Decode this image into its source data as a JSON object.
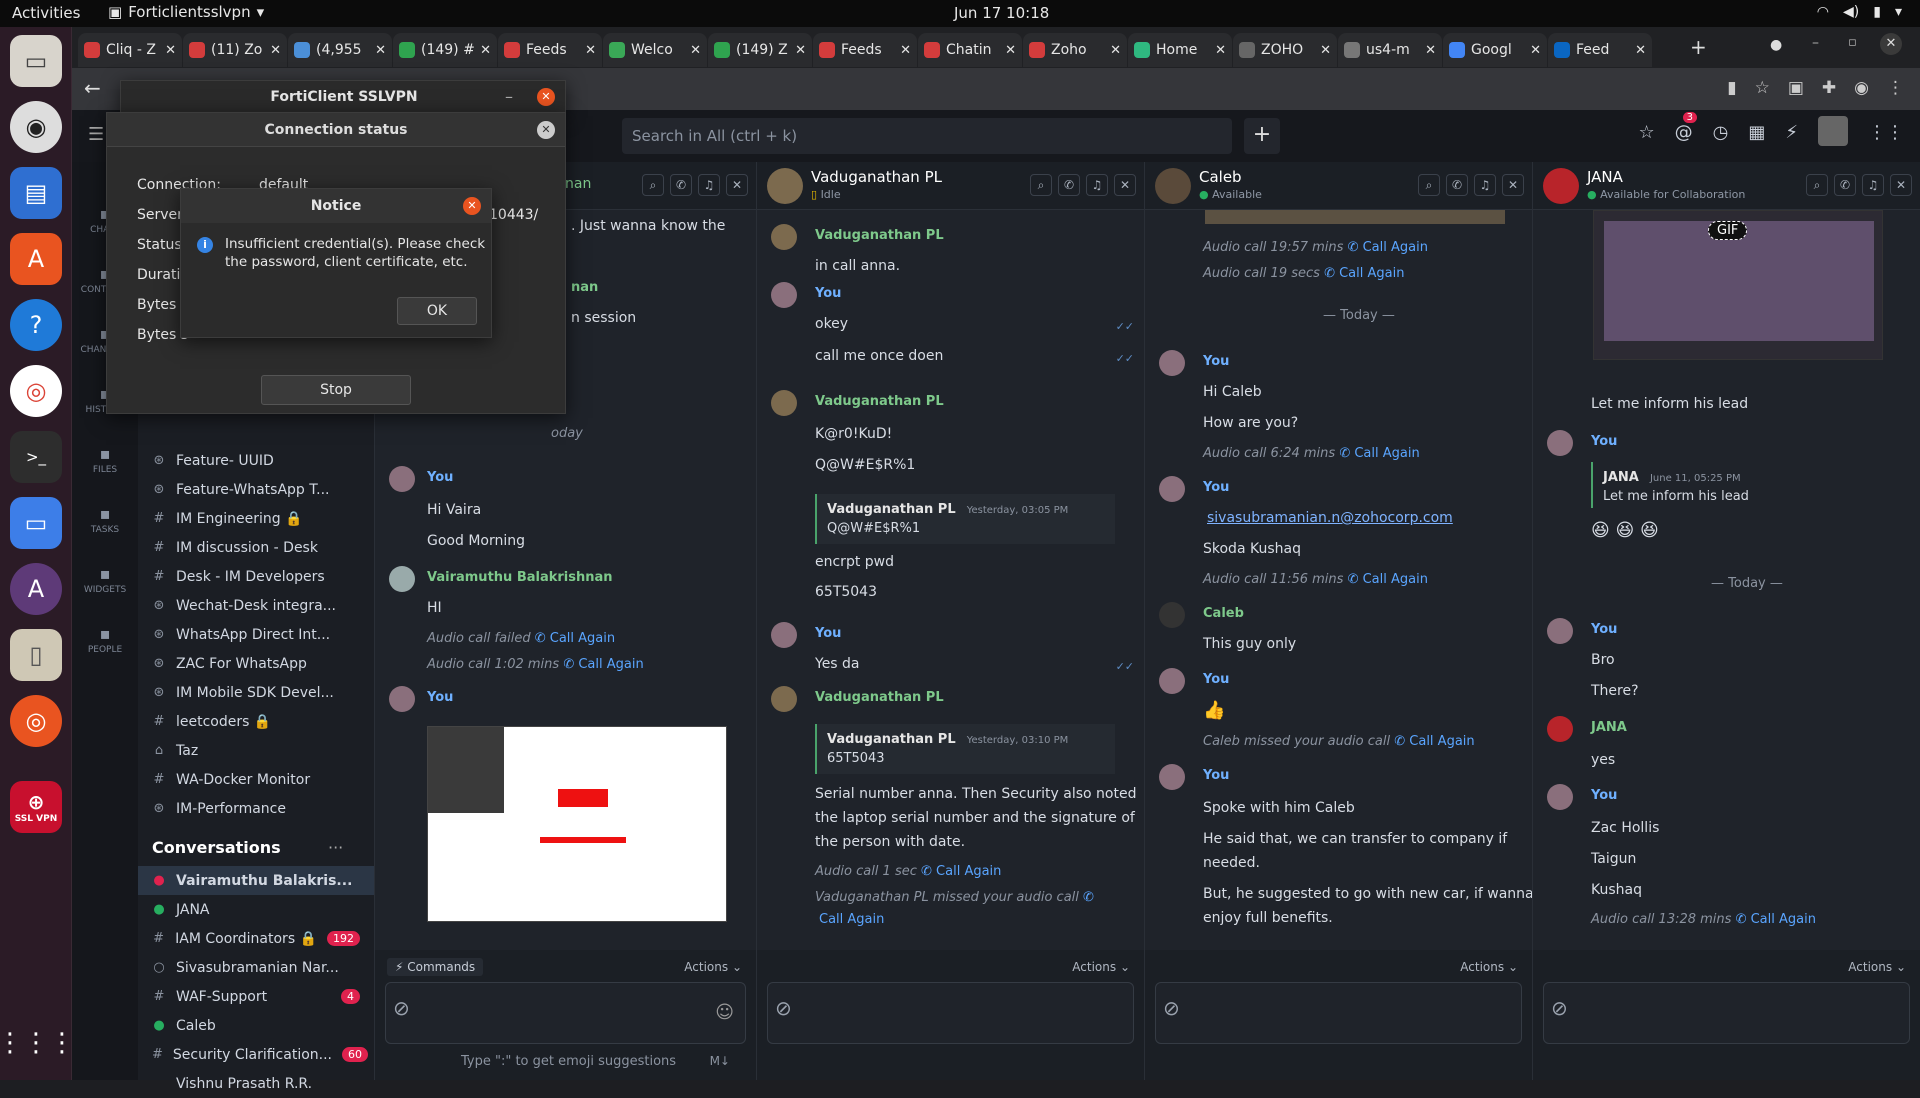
{
  "topbar": {
    "activities": "Activities",
    "app": "Forticlientsslvpn",
    "clock": "Jun 17  10:18"
  },
  "tabs": [
    {
      "label": "Cliq - Z",
      "color": "#d33c3c"
    },
    {
      "label": "(11) Zo",
      "color": "#d33c3c"
    },
    {
      "label": "(4,955",
      "color": "#4b8fd8"
    },
    {
      "label": "(149) #",
      "color": "#2fa34f"
    },
    {
      "label": "Feeds",
      "color": "#d33c3c"
    },
    {
      "label": "Welco",
      "color": "#3aa857"
    },
    {
      "label": "(149) Z",
      "color": "#2fa34f"
    },
    {
      "label": "Feeds",
      "color": "#d33c3c"
    },
    {
      "label": "Chatin",
      "color": "#d33c3c"
    },
    {
      "label": "Zoho",
      "color": "#d33c3c"
    },
    {
      "label": "Home",
      "color": "#2fb880"
    },
    {
      "label": "ZOHO",
      "color": "#666"
    },
    {
      "label": "us4-m",
      "color": "#777"
    },
    {
      "label": "Googl",
      "color": "#4285f4"
    },
    {
      "label": "Feed",
      "color": "#0a66c2"
    }
  ],
  "cliq": {
    "search_placeholder": "Search in All (ctrl + k)",
    "mention_count": "3"
  },
  "rail": [
    {
      "label": "CHATS",
      "icon": "chat-icon"
    },
    {
      "label": "CONTACTS",
      "icon": "contacts-icon"
    },
    {
      "label": "CHANNELS",
      "icon": "hash-icon"
    },
    {
      "label": "HISTORY",
      "icon": "history-icon"
    },
    {
      "label": "FILES",
      "icon": "files-icon"
    },
    {
      "label": "TASKS",
      "icon": "tasks-icon"
    },
    {
      "label": "WIDGETS",
      "icon": "widgets-icon"
    },
    {
      "label": "PEOPLE",
      "icon": "people-icon"
    }
  ],
  "channels": [
    {
      "sym": "⊛",
      "name": "Feature- UUID"
    },
    {
      "sym": "⊛",
      "name": "Feature-WhatsApp T..."
    },
    {
      "sym": "#",
      "name": "IM Engineering 🔒"
    },
    {
      "sym": "#",
      "name": "IM discussion - Desk"
    },
    {
      "sym": "#",
      "name": "Desk - IM Developers"
    },
    {
      "sym": "⊛",
      "name": "Wechat-Desk integra..."
    },
    {
      "sym": "⊛",
      "name": "WhatsApp Direct Int..."
    },
    {
      "sym": "⊛",
      "name": "ZAC For WhatsApp"
    },
    {
      "sym": "⊛",
      "name": "IM Mobile SDK Devel..."
    },
    {
      "sym": "#",
      "name": "leetcoders 🔒"
    },
    {
      "sym": "⌂",
      "name": "Taz"
    },
    {
      "sym": "#",
      "name": "WA-Docker Monitor"
    },
    {
      "sym": "⊛",
      "name": "IM-Performance"
    }
  ],
  "conversations_title": "Conversations",
  "conversations": [
    {
      "sym": "●",
      "name": "Vairamuthu Balakris...",
      "badge": "",
      "color": "#e0224e"
    },
    {
      "sym": "●",
      "name": "JANA",
      "badge": "",
      "color": "#27ae60"
    },
    {
      "sym": "#",
      "name": "IAM Coordinators 🔒",
      "badge": "192",
      "color": ""
    },
    {
      "sym": "○",
      "name": "Sivasubramanian Nar...",
      "badge": "",
      "color": ""
    },
    {
      "sym": "#",
      "name": "WAF-Support",
      "badge": "4",
      "color": ""
    },
    {
      "sym": "●",
      "name": "Caleb",
      "badge": "",
      "color": "#27ae60"
    },
    {
      "sym": "#",
      "name": "Security Clarification...",
      "badge": "60",
      "color": ""
    },
    {
      "sym": "",
      "name": "Vishnu Prasath R.R.",
      "badge": "",
      "color": ""
    }
  ],
  "pane1": {
    "peek": "nan",
    "msg_top": ". Just wanna know the",
    "peek2": "nan",
    "msg_top2": "n session",
    "today": "oday",
    "you1": "You",
    "m1": "Hi Vaira",
    "m2": "Good Morning",
    "vb": "Vairamuthu Balakrishnan",
    "m3": "HI",
    "c1": "Audio call failed",
    "c2": "Audio call 1:02 mins",
    "call_again": "Call Again",
    "you2": "You",
    "commands": "Commands",
    "actions": "Actions",
    "hint": "Type \":\" to get emoji suggestions",
    "md": "M↓"
  },
  "pane2": {
    "name": "Vaduganathan PL",
    "status": "Idle",
    "u1": "Vaduganathan PL",
    "m1": "in call anna.",
    "u2": "You",
    "m2": "okey",
    "m3": "call me once doen",
    "u3": "Vaduganathan PL",
    "m4": "K@r0!KuD!",
    "m5": "Q@W#E$R%1",
    "q1_name": "Vaduganathan PL",
    "q1_time": "Yesterday, 03:05 PM",
    "q1_text": "Q@W#E$R%1",
    "m6": "encrpt pwd",
    "m7": "65T5043",
    "u4": "You",
    "m8": "Yes da",
    "u5": "Vaduganathan PL",
    "q2_name": "Vaduganathan PL",
    "q2_time": "Yesterday, 03:10 PM",
    "q2_text": "65T5043",
    "m9": "Serial number anna. Then Security also noted",
    "m10": "the laptop serial number and the signature of",
    "m11": "the person with date.",
    "c1": "Audio call 1 sec",
    "c2": "Vaduganathan PL missed your audio call",
    "call_again": "Call Again",
    "actions": "Actions"
  },
  "pane3": {
    "name": "Caleb",
    "status": "Available",
    "c1": "Audio call 19:57 mins",
    "c2": "Audio call 19 secs",
    "call_again": "Call Again",
    "today": "Today",
    "u1": "You",
    "m1": "Hi Caleb",
    "m2": "How are you?",
    "c3": "Audio call 6:24 mins",
    "u2": "You",
    "email": "sivasubramanian.n@zohocorp.com",
    "m3": "Skoda Kushaq",
    "c4": "Audio call 11:56 mins",
    "u3": "Caleb",
    "m4": "This guy only",
    "u4": "You",
    "thumb": "👍",
    "c5": "Caleb missed your audio call",
    "u5": "You",
    "m5": "Spoke with him Caleb",
    "m6": "He said that, we can transfer to company if",
    "m7": "needed.",
    "m8": "But, he suggested to go with new car, if wanna",
    "m9": "enjoy full benefits.",
    "actions": "Actions"
  },
  "pane4": {
    "name": "JANA",
    "status": "Available for Collaboration",
    "gif": "GIF",
    "m1": "Let me inform his lead",
    "u1": "You",
    "q_name": "JANA",
    "q_time": "June 11, 05:25 PM",
    "q_text": "Let me inform his lead",
    "emojis": "😆  😆  😆",
    "today": "Today",
    "u2": "You",
    "m2": "Bro",
    "m3": "There?",
    "u3": "JANA",
    "m4": "yes",
    "u4": "You",
    "m5": "Zac Hollis",
    "m6": "Taigun",
    "m7": "Kushaq",
    "c1": "Audio call 13:28 mins",
    "call_again": "Call Again",
    "actions": "Actions"
  },
  "forti": {
    "title": "FortiClient SSLVPN",
    "status_title": "Connection status",
    "rows": [
      "Connection:",
      "Server:",
      "Status:",
      "Duratic",
      "Bytes r",
      "Bytes s"
    ],
    "conn_val": "default",
    "server_val": "10443/",
    "stop": "Stop",
    "notice_title": "Notice",
    "notice_msg1": "Insufficient credential(s). Please check",
    "notice_msg2": "the password, client certificate, etc.",
    "ok": "OK"
  },
  "dock_labels": {
    "sslvpn": "SSL VPN"
  }
}
